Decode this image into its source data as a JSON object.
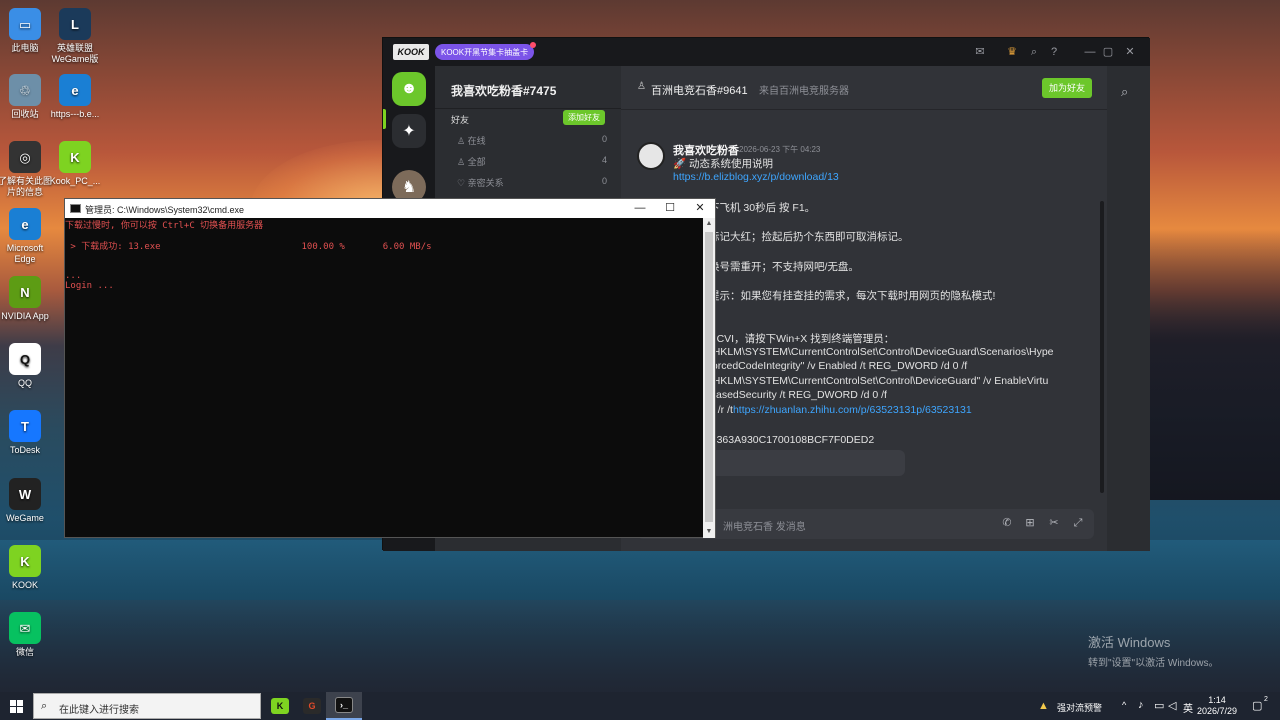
{
  "desktop": {
    "icons": [
      {
        "label": "此电脑",
        "glyph": "▭",
        "color": "#3a8ee6"
      },
      {
        "label": "英雄联盟\nWeGame版",
        "glyph": "L",
        "color": "#1b3a5a"
      },
      {
        "label": "回收站",
        "glyph": "♲",
        "color": "#6d8fa8"
      },
      {
        "label": "https---b.e...",
        "glyph": "e",
        "color": "#1a7fd4"
      },
      {
        "label": "了解有关此图\n片的信息",
        "glyph": "◎",
        "color": "#333"
      },
      {
        "label": "Kook_PC_...",
        "glyph": "K",
        "color": "#7ed321"
      },
      {
        "label": "Microsoft\nEdge",
        "glyph": "e",
        "color": "#1a7fd4"
      },
      {
        "label": "NVIDIA App",
        "glyph": "N",
        "color": "#5d9c14"
      },
      {
        "label": "QQ",
        "glyph": "Q",
        "color": "#ffffff"
      },
      {
        "label": "ToDesk",
        "glyph": "T",
        "color": "#1677ff"
      },
      {
        "label": "WeGame",
        "glyph": "W",
        "color": "#222"
      },
      {
        "label": "KOOK",
        "glyph": "K",
        "color": "#7ed321"
      },
      {
        "label": "微信",
        "glyph": "✉",
        "color": "#07c160"
      }
    ],
    "activate_title": "激活 Windows",
    "activate_sub": "转到\"设置\"以激活 Windows。"
  },
  "kook": {
    "logo": "KOOK",
    "promo": "KOOK开黑节集卡抽盖卡",
    "user": "我喜欢吃粉香#7475",
    "friends_header": "好友",
    "add_friend": "添加好友",
    "friend_rows": [
      {
        "label": "在线",
        "count": "0"
      },
      {
        "label": "全部",
        "count": "4"
      },
      {
        "label": "亲密关系",
        "count": "0"
      }
    ],
    "chat_name": "百洲电竞石香#9641",
    "chat_from": "来自百洲电竞服务器",
    "chat_add": "加为好友",
    "msg_user": "我喜欢吃粉香",
    "msg_time": "2026-06-23 下午 04:23",
    "msg_line1": "🚀 动态系统使用说明",
    "msg_link": "https://b.elizblog.xyz/p/download/13",
    "lines": [
      "下飞机 30秒后 按 F1。",
      "标记大红；捡起后扔个东西即可取消标记。",
      "换号需重开；不支持网吧/无盘。",
      "提示：如果您有挂查挂的需求，每次下载时用网页的隐私模式!",
      ":",
      "HCVI，请按下Win+X 找到终端管理员：",
      "\"HKLM\\SYSTEM\\CurrentControlSet\\Control\\DeviceGuard\\Scenarios\\Hype",
      "forcedCodeIntegrity\" /v Enabled /t REG_DWORD /d 0 /f",
      "\"HKLM\\SYSTEM\\CurrentControlSet\\Control\\DeviceGuard\" /v EnableVirtu",
      "BasedSecurity /t REG_DWORD /d 0 /f",
      "D363A930C1700108BCF7F0DED2"
    ],
    "reg_link_prefix": "n /r /t",
    "reg_link": "https://zhuanlan.zhihu.com/p/63523131p/63523131",
    "input_placeholder": "洲电竞石香 发消息"
  },
  "cmd": {
    "title": "管理员: C:\\Windows\\System32\\cmd.exe",
    "lines": [
      "下载过慢时, 你可以按 Ctrl+C 切换备用服务器",
      "",
      " > 下载成功: 13.exe                          100.00 %       6.00 MB/s",
      "",
      "",
      "...",
      "Login ..."
    ]
  },
  "taskbar": {
    "search_placeholder": "在此键入进行搜索",
    "weather": "强对流预警",
    "ime": "英",
    "time": "1:14",
    "date": "2026/7/29",
    "notifications": "2"
  }
}
